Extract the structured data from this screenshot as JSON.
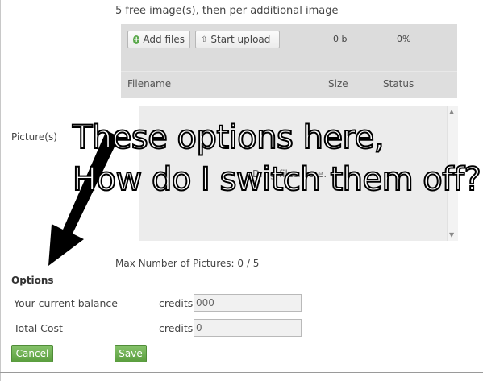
{
  "header": {
    "free_note": "5 free image(s), then per additional image"
  },
  "uploader": {
    "add_files_label": "Add files",
    "start_upload_label": "Start upload",
    "total_size": "0 b",
    "total_percent": "0%",
    "columns": {
      "filename": "Filename",
      "size": "Size",
      "status": "Status"
    },
    "drop_hint": "Drag files here."
  },
  "pictures": {
    "label": "Picture(s)",
    "max_note": "Max Number of Pictures: 0 / 5"
  },
  "annotation": {
    "line1": "These options here,",
    "line2": "How do I switch them off?"
  },
  "options": {
    "title": "Options",
    "balance_label": "Your current balance",
    "balance_unit": "credits",
    "balance_value": "000",
    "total_label": "Total Cost",
    "total_unit": "credits",
    "total_value": "0"
  },
  "actions": {
    "cancel_label": "Cancel",
    "save_label": "Save"
  },
  "colors": {
    "button_green": "#6aae4e",
    "panel_gray": "#dcdcdc"
  }
}
